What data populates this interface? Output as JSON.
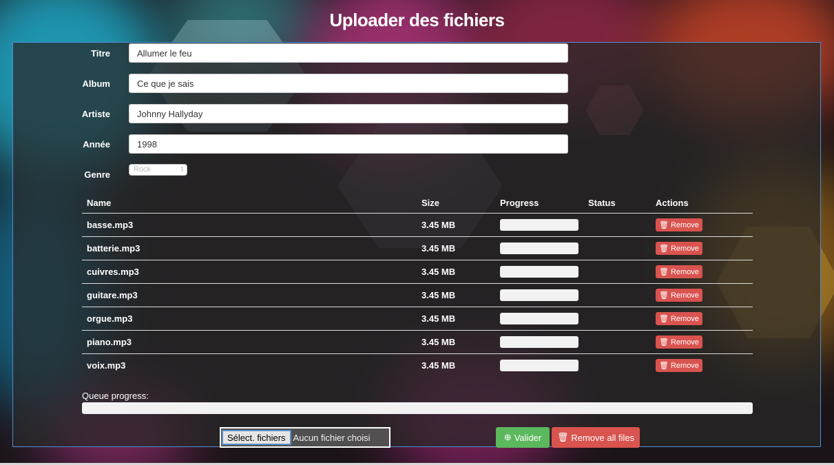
{
  "page_title": "Uploader des fichiers",
  "form": {
    "titre_label": "Titre",
    "titre_value": "Allumer le feu",
    "album_label": "Album",
    "album_value": "Ce que je sais",
    "artiste_label": "Artiste",
    "artiste_value": "Johnny Hallyday",
    "annee_label": "Année",
    "annee_value": "1998",
    "genre_label": "Genre",
    "genre_value": "Rock"
  },
  "table": {
    "headers": [
      "Name",
      "Size",
      "Progress",
      "Status",
      "Actions"
    ],
    "rows": [
      {
        "name": "basse.mp3",
        "size": "3.45 MB",
        "status": "",
        "progress": 0
      },
      {
        "name": "batterie.mp3",
        "size": "3.45 MB",
        "status": "",
        "progress": 0
      },
      {
        "name": "cuivres.mp3",
        "size": "3.45 MB",
        "status": "",
        "progress": 0
      },
      {
        "name": "guitare.mp3",
        "size": "3.45 MB",
        "status": "",
        "progress": 0
      },
      {
        "name": "orgue.mp3",
        "size": "3.45 MB",
        "status": "",
        "progress": 0
      },
      {
        "name": "piano.mp3",
        "size": "3.45 MB",
        "status": "",
        "progress": 0
      },
      {
        "name": "voix.mp3",
        "size": "3.45 MB",
        "status": "",
        "progress": 0
      }
    ],
    "remove_label": "Remove"
  },
  "queue": {
    "label": "Queue progress:",
    "progress": 0
  },
  "footer": {
    "select_files_label": "Sélect. fichiers",
    "no_file_label": "Aucun fichier choisi",
    "validate_label": "Valider",
    "remove_all_label": "Remove all files"
  },
  "icons": {
    "remove": "trash-icon",
    "validate": "upload-circle-icon"
  },
  "colors": {
    "danger": "#d9534f",
    "success": "#5cb85c",
    "panel_border": "#4f8fd6"
  }
}
